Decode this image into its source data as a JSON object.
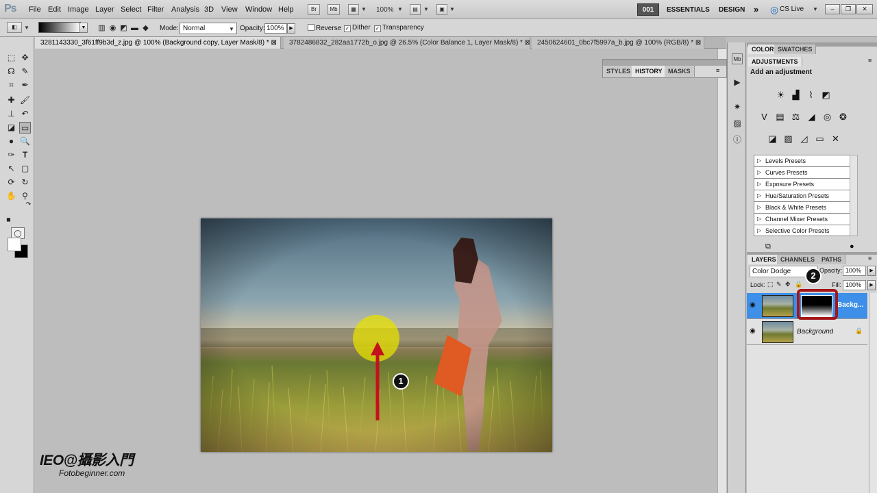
{
  "app": {
    "logo": "Ps"
  },
  "menu": [
    "File",
    "Edit",
    "Image",
    "Layer",
    "Select",
    "Filter",
    "Analysis",
    "3D",
    "View",
    "Window",
    "Help"
  ],
  "appbar": {
    "bridge": "Br",
    "minibridge": "Mb",
    "zoom": "100%",
    "workspace_num": "001",
    "workspace_labels": [
      "ESSENTIALS",
      "DESIGN"
    ],
    "overflow": "»",
    "cslive": "CS Live"
  },
  "options": {
    "mode_label": "Mode:",
    "mode_value": "Normal",
    "opacity_label": "Opacity:",
    "opacity_value": "100%",
    "reverse_label": "Reverse",
    "dither_label": "Dither",
    "transparency_label": "Transparency",
    "reverse_checked": false,
    "dither_checked": true,
    "transparency_checked": true
  },
  "doc_tabs": [
    {
      "label": "3281143330_3f61ff9b3d_z.jpg @ 100% (Background copy, Layer Mask/8) *",
      "active": true
    },
    {
      "label": "3782486832_282aa1772b_o.jpg @ 26.5% (Color Balance 1, Layer Mask/8) *",
      "active": false
    },
    {
      "label": "2450624601_0bc7f5997a_b.jpg @ 100% (RGB/8) *",
      "active": false
    }
  ],
  "float_panel": {
    "tabs": [
      "STYLES",
      "HISTORY",
      "MASKS"
    ],
    "active": "HISTORY"
  },
  "color_panel": {
    "tabs": [
      "COLOR",
      "SWATCHES"
    ]
  },
  "adjustments": {
    "tab": "ADJUSTMENTS",
    "heading": "Add an adjustment",
    "presets": [
      "Levels Presets",
      "Curves Presets",
      "Exposure Presets",
      "Hue/Saturation Presets",
      "Black & White Presets",
      "Channel Mixer Presets",
      "Selective Color Presets"
    ]
  },
  "layers": {
    "tabs": [
      "LAYERS",
      "CHANNELS",
      "PATHS"
    ],
    "blend_mode": "Color Dodge",
    "opacity_label": "Opacity:",
    "opacity_value": "100%",
    "lock_label": "Lock:",
    "fill_label": "Fill:",
    "fill_value": "100%",
    "rows": [
      {
        "name": "Backg...",
        "selected": true
      },
      {
        "name": "Background",
        "selected": false
      }
    ]
  },
  "callouts": [
    "1",
    "2"
  ],
  "watermark": {
    "line1": "IEO@攝影入門",
    "line2": "Fotobeginner.com"
  },
  "colors": {
    "accent_selected_layer": "#3d8fe8",
    "annotation_red": "#a3171b",
    "highlight_yellow": "#e6e000"
  }
}
